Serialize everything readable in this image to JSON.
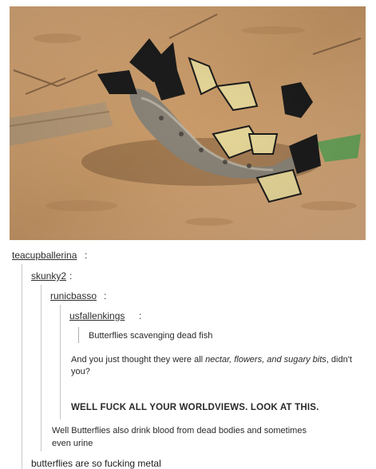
{
  "image": {
    "alt_icon": "photo-butterflies-on-fish"
  },
  "thread": {
    "users": [
      "teacupballerina",
      "skunky2",
      "runicbasso",
      "usfallenkings"
    ],
    "colon": ":",
    "quote": "Butterflies scavenging dead fish",
    "reply1_a": "And you just thought they were all ",
    "reply1_ital": "nectar, flowers, and sugary bits",
    "reply1_b": ", didn't you?",
    "reply2": "WELL FUCK ALL YOUR WORLDVIEWS. LOOK AT THIS.",
    "reply3_line1": "Well Butterflies also drink blood from dead bodies and sometimes",
    "reply3_line2": "even urine",
    "final": "butterflies are so fucking metal"
  },
  "colors": {
    "sand": "#c99a68",
    "fish": "#8a8478",
    "butterfly_yellow": "#e8d89a",
    "butterfly_dark": "#1c1c1c",
    "leaf": "#6aa35a"
  }
}
